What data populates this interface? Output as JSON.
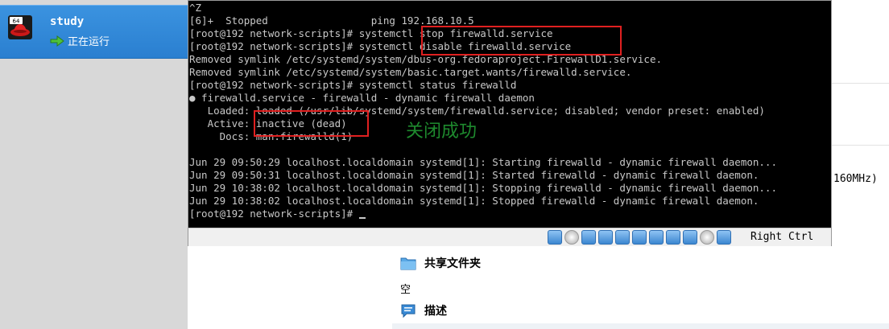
{
  "vm_list": {
    "selected": {
      "name": "study",
      "os_badge": "64",
      "state": "正在运行"
    }
  },
  "console": {
    "lines": [
      "^Z",
      "[6]+  Stopped                 ping 192.168.10.5",
      "[root@192 network-scripts]# systemctl stop firewalld.service",
      "[root@192 network-scripts]# systemctl disable firewalld.service",
      "Removed symlink /etc/systemd/system/dbus-org.fedoraproject.FirewallD1.service.",
      "Removed symlink /etc/systemd/system/basic.target.wants/firewalld.service.",
      "[root@192 network-scripts]# systemctl status firewalld",
      "● firewalld.service - firewalld - dynamic firewall daemon",
      "   Loaded: loaded (/usr/lib/systemd/system/firewalld.service; disabled; vendor preset: enabled)",
      "   Active: inactive (dead)",
      "     Docs: man:firewalld(1)",
      "",
      "Jun 29 09:50:29 localhost.localdomain systemd[1]: Starting firewalld - dynamic firewall daemon...",
      "Jun 29 09:50:31 localhost.localdomain systemd[1]: Started firewalld - dynamic firewall daemon.",
      "Jun 29 10:38:02 localhost.localdomain systemd[1]: Stopping firewalld - dynamic firewall daemon...",
      "Jun 29 10:38:02 localhost.localdomain systemd[1]: Stopped firewalld - dynamic firewall daemon.",
      "[root@192 network-scripts]# "
    ],
    "annotation": "关闭成功",
    "host_key": "Right Ctrl",
    "status_icons": [
      "hard-disk-icon",
      "optical-drive-icon",
      "audio-icon",
      "network-icon",
      "usb-icon",
      "shared-folders-icon",
      "display-icon",
      "video-capture-icon",
      "virtualization-icon",
      "mouse-integration-icon",
      "keyboard-capture-icon"
    ]
  },
  "details": {
    "cpu_fragment": "160MHz)",
    "shared_folders": {
      "title": "共享文件夹",
      "value": "空"
    },
    "description": {
      "title": "描述"
    }
  },
  "colors": {
    "selection": "#2a7fd0",
    "highlight_box": "#e02020",
    "annotation": "#1e8a2e",
    "terminal_bg": "#000000",
    "terminal_fg": "#c8c8c8"
  }
}
